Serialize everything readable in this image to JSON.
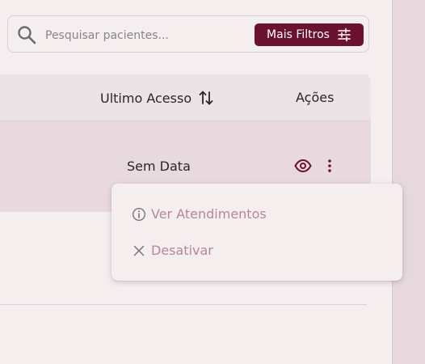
{
  "search": {
    "placeholder": "Pesquisar pacientes...",
    "filter_button_label": "Mais Filtros"
  },
  "table": {
    "columns": [
      {
        "label": "Ultimo Acesso",
        "icon": "sort-icon"
      },
      {
        "label": "Ações"
      }
    ],
    "rows": [
      {
        "last_access": "Sem Data",
        "actions": [
          "eye-icon",
          "more-vertical-icon"
        ]
      }
    ]
  },
  "menu": {
    "items": [
      {
        "label": "Ver Atendimentos",
        "icon": "info-icon"
      },
      {
        "label": "Desativar",
        "icon": "close-icon"
      }
    ]
  },
  "colors": {
    "accent": "#6b1232",
    "menu_text": "#b58799",
    "row_highlight": "#e8d9de",
    "background": "#f4eeef"
  }
}
